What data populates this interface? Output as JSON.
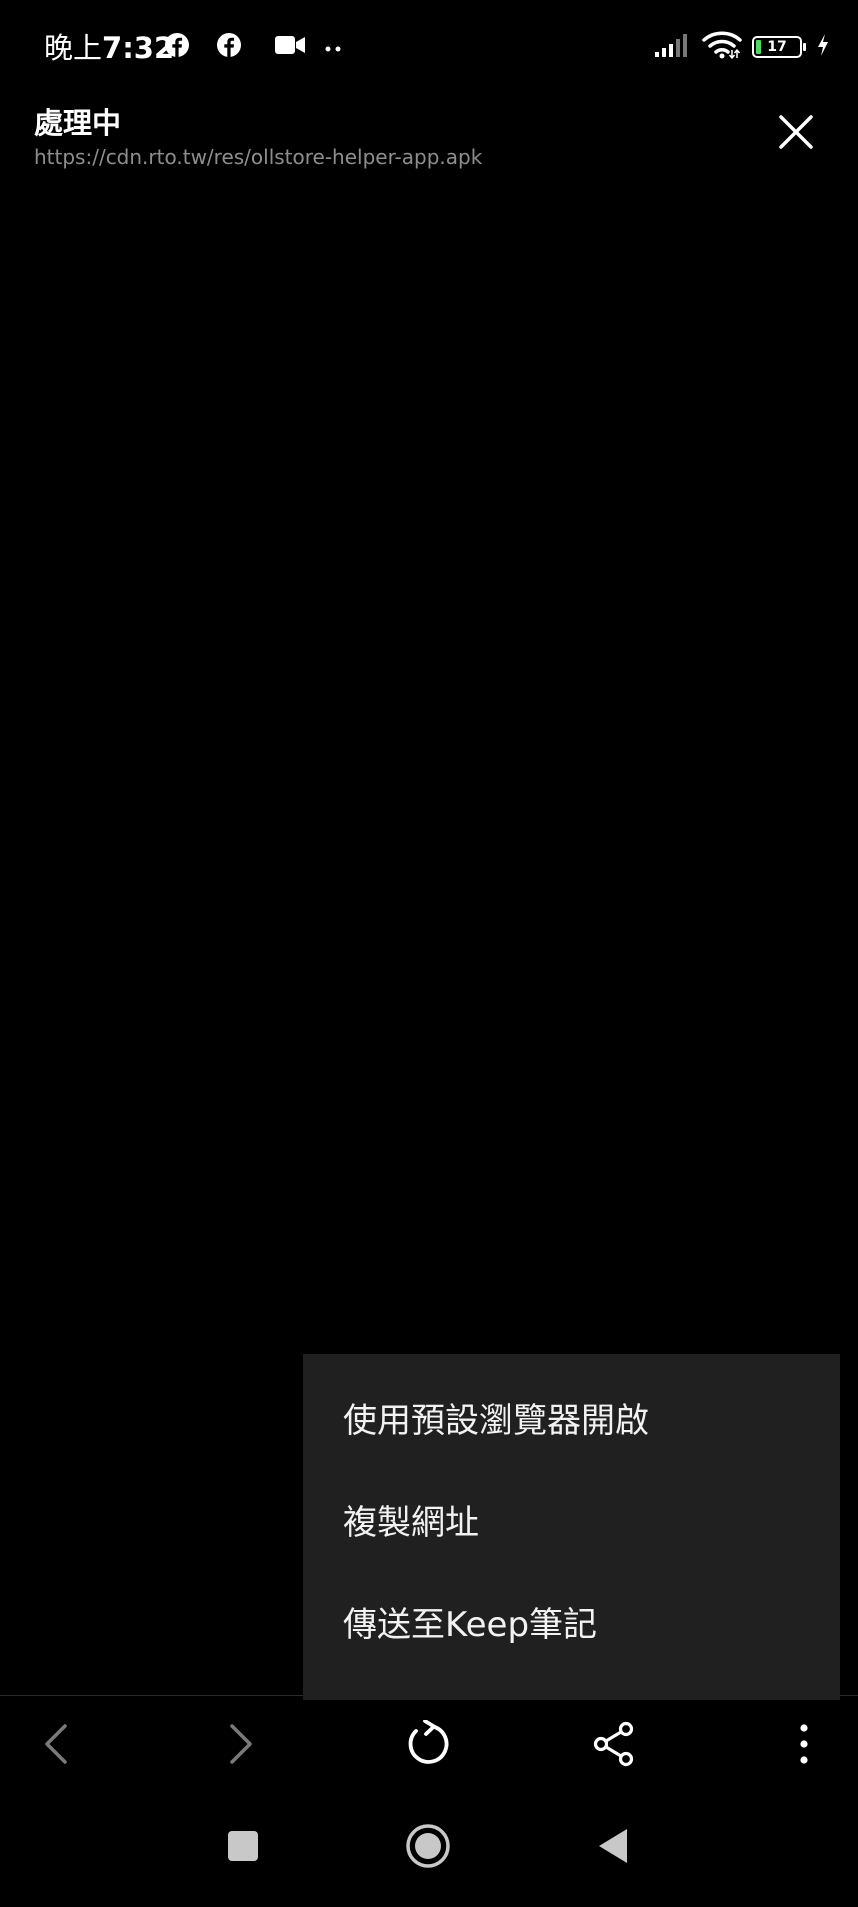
{
  "status_bar": {
    "time_prefix": "晚上",
    "time": "7:32",
    "battery_level": "17",
    "icons_left": [
      "facebook-icon",
      "facebook-icon",
      "video-camera-icon",
      "more-dots-icon"
    ],
    "icons_right": [
      "signal-icon",
      "wifi-icon",
      "battery-icon",
      "charging-icon"
    ]
  },
  "header": {
    "title": "處理中",
    "url": "https://cdn.rto.tw/res/ollstore-helper-app.apk",
    "close_icon": "close-icon"
  },
  "menu": {
    "items": [
      {
        "label": "使用預設瀏覽器開啟"
      },
      {
        "label": "複製網址"
      },
      {
        "label": "傳送至Keep筆記"
      }
    ]
  },
  "toolbar": {
    "icons": [
      "back-arrow-icon",
      "forward-arrow-icon",
      "reload-icon",
      "share-icon",
      "more-vert-icon"
    ]
  },
  "system_nav": {
    "icons": [
      "recents-icon",
      "home-icon",
      "back-icon"
    ]
  },
  "colors": {
    "background": "#000000",
    "menu_background": "#202020",
    "url_text": "#8e8e8e",
    "battery_fill": "#4cd964",
    "disabled_icon": "#7a7a7a"
  }
}
